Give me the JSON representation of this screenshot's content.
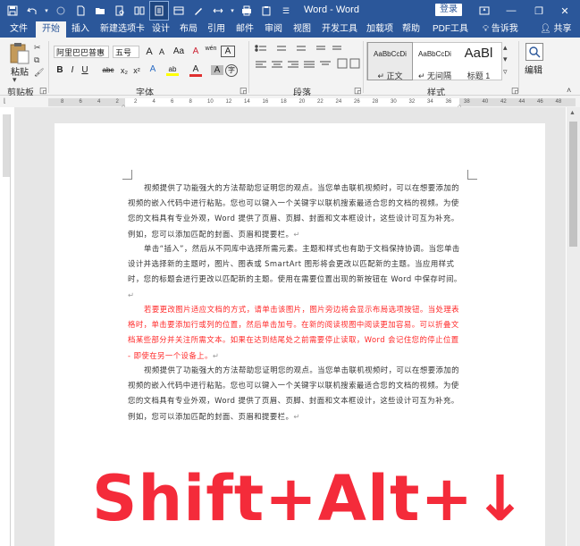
{
  "window": {
    "title": "Word - Word",
    "login_label": "登录",
    "minimize": "—",
    "restore": "❐",
    "close": "✕"
  },
  "qat": [
    "save-icon",
    "undo-icon",
    "redo-icon",
    "new-doc-icon",
    "open-icon",
    "print-preview-icon",
    "read-mode-icon",
    "more-icon",
    "draw-icon",
    "paragraph-icon",
    "clipboard-icon",
    "customize-icon"
  ],
  "tabs": [
    "文件",
    "开始",
    "插入",
    "新建选项卡",
    "设计",
    "布局",
    "引用",
    "邮件",
    "审阅",
    "视图",
    "开发工具",
    "加载项",
    "帮助",
    "PDF工具集"
  ],
  "active_tab": "开始",
  "tell_me": "告诉我",
  "share": "共享",
  "ribbon": {
    "clipboard": {
      "paste": "粘贴",
      "label": "剪贴板"
    },
    "font": {
      "font_name": "阿里巴巴普惠",
      "font_size": "五号",
      "grow": "A",
      "shrink": "A",
      "case": "Aa",
      "clear": "A",
      "phonetic": "wén",
      "border": "A",
      "bold": "B",
      "italic": "I",
      "underline": "U",
      "strike": "abc",
      "sub": "x₂",
      "sup": "x²",
      "effect": "A",
      "highlight": "ab",
      "color": "A",
      "shade": "A",
      "circle": "字",
      "label": "字体"
    },
    "paragraph": {
      "label": "段落"
    },
    "styles": {
      "items": [
        {
          "preview": "AaBbCcDi",
          "name": "↵ 正文"
        },
        {
          "preview": "AaBbCcDi",
          "name": "↵ 无间隔"
        },
        {
          "preview": "AaBl",
          "name": "标题 1"
        }
      ],
      "label": "样式"
    },
    "editing": {
      "label": "编辑"
    }
  },
  "ruler": {
    "numbers": [
      "8",
      "6",
      "4",
      "2",
      "2",
      "4",
      "6",
      "8",
      "10",
      "12",
      "14",
      "16",
      "18",
      "20",
      "22",
      "24",
      "26",
      "28",
      "30",
      "32",
      "34",
      "36",
      "38",
      "40",
      "42",
      "44",
      "46",
      "48"
    ]
  },
  "document": {
    "paragraphs": [
      {
        "text": "视频提供了功能强大的方法帮助您证明您的观点。当您单击联机视频时，可以在想要添加的视频的嵌入代码中进行粘贴。您也可以键入一个关键字以联机搜索最适合您的文档的视频。为使您的文档具有专业外观，Word 提供了页眉、页脚、封面和文本框设计，这些设计可互为补充。例如，您可以添加匹配的封面、页眉和提要栏。",
        "mark": "↵",
        "red": false
      },
      {
        "text": "单击“插入”，然后从不同库中选择所需元素。主题和样式也有助于文档保持协调。当您单击设计并选择新的主题时，图片、图表或 SmartArt 图形将会更改以匹配新的主题。当应用样式时，您的标题会进行更改以匹配新的主题。使用在需要位置出现的新按钮在 Word 中保存时间。",
        "mark": "↵",
        "red": false
      },
      {
        "text": "若要更改图片适应文档的方式，请单击该图片，图片旁边将会显示布局选项按钮。当处理表格时，单击要添加行或列的位置，然后单击加号。在新的阅读视图中阅读更加容易。可以折叠文档某些部分并关注所需文本。如果在达到结尾处之前需要停止读取，Word 会记住您的停止位置 - 即使在另一个设备上。",
        "mark": "↵",
        "red": true
      },
      {
        "text": "视频提供了功能强大的方法帮助您证明您的观点。当您单击联机视频时，可以在想要添加的视频的嵌入代码中进行粘贴。您也可以键入一个关键字以联机搜索最适合您的文档的视频。为使您的文档具有专业外观，Word 提供了页眉、页脚、封面和文本框设计，这些设计可互为补充。例如，您可以添加匹配的封面、页眉和提要栏。",
        "mark": "↵",
        "red": false
      }
    ],
    "shortcut_overlay": "Shift+Alt+↓"
  },
  "colors": {
    "accent": "#2b579a",
    "overlay_red": "#f42b3a",
    "red_text": "#ff2828"
  }
}
